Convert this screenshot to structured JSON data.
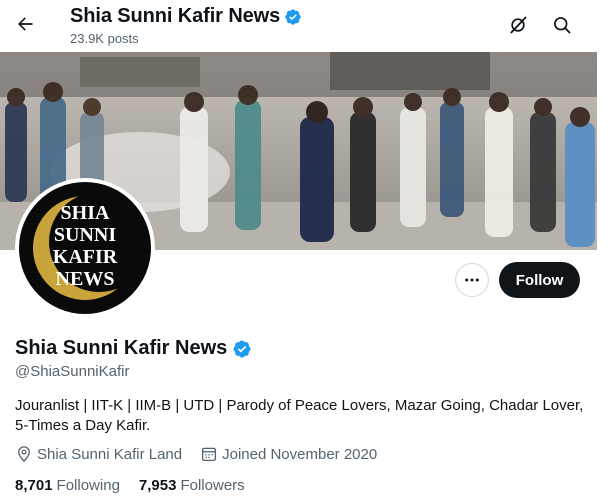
{
  "header": {
    "title": "Shia Sunni Kafir News",
    "posts": "23.9K posts"
  },
  "profile": {
    "display_name": "Shia Sunni Kafir News",
    "handle": "@ShiaSunniKafir",
    "bio": "Jouranlist | IIT-K | IIM-B | UTD | Parody of Peace Lovers, Mazar Going, Chadar Lover, 5-Times a Day Kafir.",
    "location": "Shia Sunni Kafir Land",
    "joined": "Joined November 2020",
    "following_count": "8,701",
    "following_label": "Following",
    "followers_count": "7,953",
    "followers_label": "Followers"
  },
  "avatar": {
    "text_lines": [
      "SHIA",
      "SUNNI",
      "KAFIR",
      "NEWS"
    ]
  },
  "actions": {
    "follow_label": "Follow"
  },
  "colors": {
    "verified": "#1d9bf0",
    "follow_bg": "#0f1419",
    "secondary_text": "#536471",
    "crescent": "#c9a43a"
  },
  "icons": {
    "back": "arrow-left-icon",
    "grok": "grok-icon",
    "search": "search-icon",
    "more": "more-dots-icon",
    "verified": "verified-badge-icon",
    "location": "location-pin-icon",
    "calendar": "calendar-icon"
  }
}
